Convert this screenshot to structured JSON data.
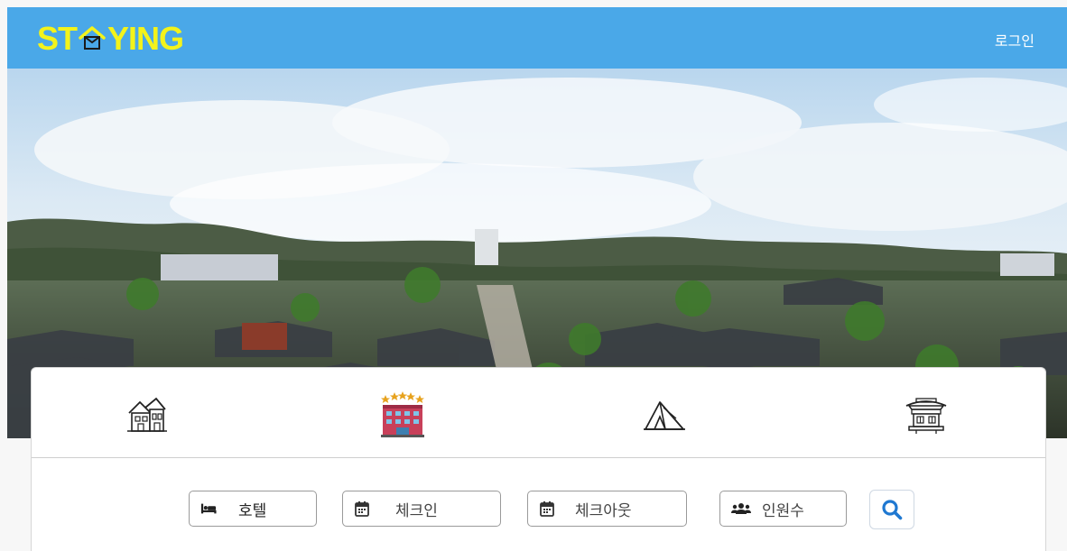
{
  "header": {
    "logo_left": "ST",
    "logo_right": "YING",
    "logo_icon": "house-icon",
    "login_label": "로그인",
    "background_color": "#4aa8e8",
    "logo_color": "#f3f31b"
  },
  "hero": {
    "image": "village-panorama"
  },
  "accommodation_types": [
    {
      "icon": "guesthouse-icon"
    },
    {
      "icon": "hotel-icon"
    },
    {
      "icon": "camping-tent-icon"
    },
    {
      "icon": "hanok-icon"
    }
  ],
  "search": {
    "type_value": "호텔",
    "checkin_placeholder": "체크인",
    "checkout_placeholder": "체크아웃",
    "guests_placeholder": "인원수",
    "search_icon": "search-icon",
    "accent_color": "#1f78d1"
  }
}
